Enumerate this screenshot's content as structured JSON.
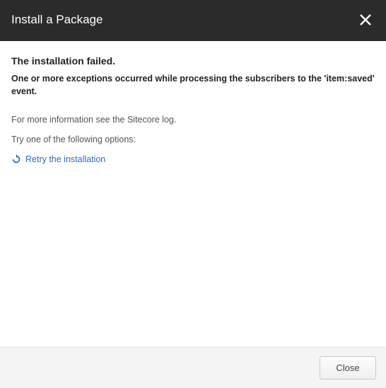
{
  "header": {
    "title": "Install a Package"
  },
  "content": {
    "fail_title": "The installation failed.",
    "fail_message": "One or more exceptions occurred while processing the subscribers to the 'item:saved' event.",
    "more_info": "For more information see the Sitecore log.",
    "try_options": "Try one of the following options:",
    "retry_label": "Retry the installation"
  },
  "footer": {
    "close_label": "Close"
  }
}
